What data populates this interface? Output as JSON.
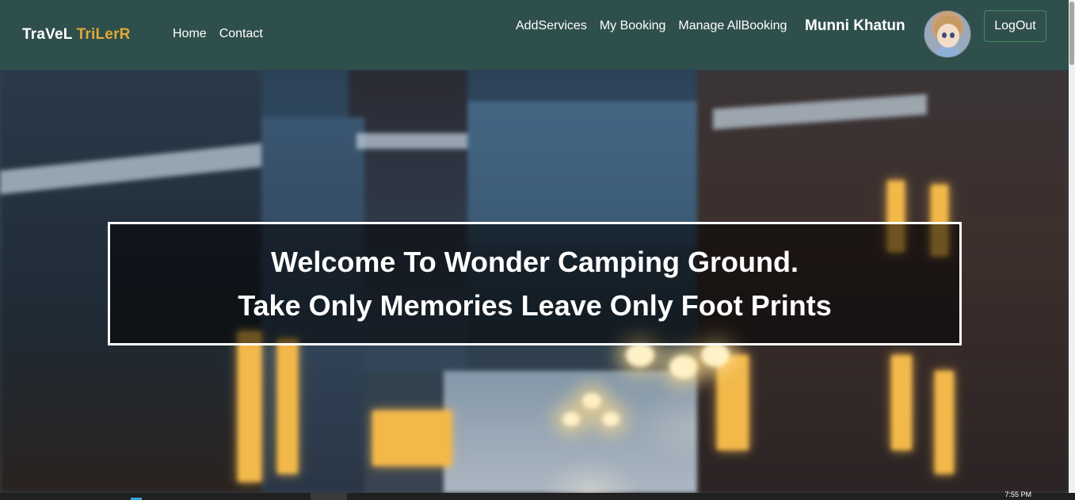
{
  "brand": {
    "part1": "TraVeL",
    "part2": "TriLerR"
  },
  "nav_left": [
    "Home",
    "Contact"
  ],
  "nav_right": [
    "AddServices",
    "My Booking",
    "Manage AllBooking"
  ],
  "user": {
    "name": "Munni Khatun"
  },
  "logout_label": "LogOut",
  "hero": {
    "line1": "Welcome To Wonder Camping Ground.",
    "line2": "Take Only Memories Leave Only Foot Prints"
  },
  "taskbar": {
    "time": "7:55 PM"
  },
  "colors": {
    "navbar_bg": "#2f4f4c",
    "brand_accent": "#e0a93a",
    "logout_border": "#3e8a66"
  }
}
